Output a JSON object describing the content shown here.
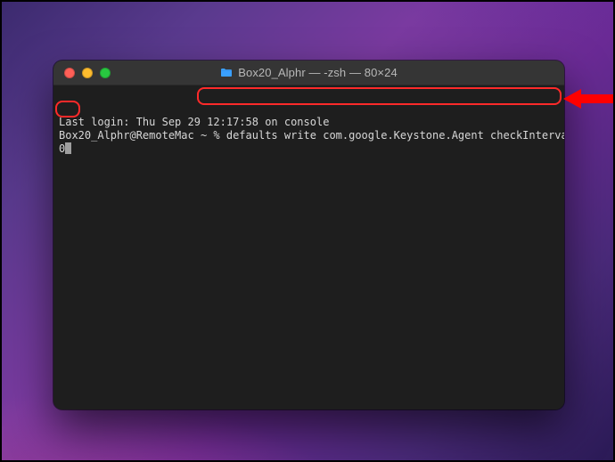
{
  "window": {
    "title": "Box20_Alphr — -zsh — 80×24"
  },
  "terminal": {
    "last_login_line": "Last login: Thu Sep 29 12:17:58 on console",
    "prompt": "Box20_Alphr@RemoteMac ~ % ",
    "command_part1": "defaults write com.google.Keystone.Agent checkInterval",
    "command_part2": "0"
  },
  "icons": {
    "folder": "folder-icon",
    "scroll": "scrollback-indicator-icon",
    "arrow": "callout-arrow-icon"
  }
}
